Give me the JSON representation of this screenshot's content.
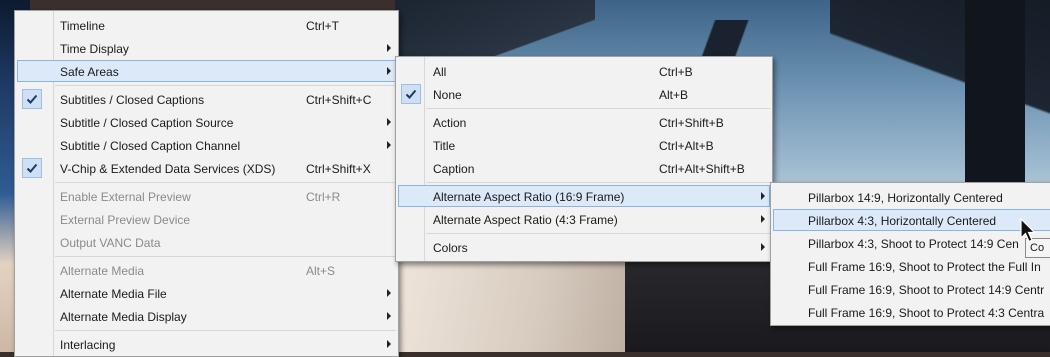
{
  "main_menu": {
    "items": [
      {
        "label": "Timeline",
        "shortcut": "Ctrl+T"
      },
      {
        "label": "Time Display",
        "shortcut": ""
      },
      {
        "label": "Safe Areas",
        "shortcut": ""
      },
      {
        "label": "Subtitles / Closed Captions",
        "shortcut": "Ctrl+Shift+C"
      },
      {
        "label": "Subtitle / Closed Caption Source",
        "shortcut": ""
      },
      {
        "label": "Subtitle / Closed Caption Channel",
        "shortcut": ""
      },
      {
        "label": "V-Chip & Extended Data Services (XDS)",
        "shortcut": "Ctrl+Shift+X"
      },
      {
        "label": "Enable External Preview",
        "shortcut": "Ctrl+R"
      },
      {
        "label": "External Preview Device",
        "shortcut": ""
      },
      {
        "label": "Output VANC Data",
        "shortcut": ""
      },
      {
        "label": "Alternate Media",
        "shortcut": "Alt+S"
      },
      {
        "label": "Alternate Media File",
        "shortcut": ""
      },
      {
        "label": "Alternate Media Display",
        "shortcut": ""
      },
      {
        "label": "Interlacing",
        "shortcut": ""
      }
    ]
  },
  "safe_areas_menu": {
    "items": [
      {
        "label": "All",
        "shortcut": "Ctrl+B"
      },
      {
        "label": "None",
        "shortcut": "Alt+B"
      },
      {
        "label": "Action",
        "shortcut": "Ctrl+Shift+B"
      },
      {
        "label": "Title",
        "shortcut": "Ctrl+Alt+B"
      },
      {
        "label": "Caption",
        "shortcut": "Ctrl+Alt+Shift+B"
      },
      {
        "label": "Alternate Aspect Ratio (16:9 Frame)",
        "shortcut": ""
      },
      {
        "label": "Alternate Aspect Ratio (4:3 Frame)",
        "shortcut": ""
      },
      {
        "label": "Colors",
        "shortcut": ""
      }
    ]
  },
  "aspect_menu": {
    "items": [
      {
        "label": "Pillarbox 14:9, Horizontally Centered"
      },
      {
        "label": "Pillarbox 4:3, Horizontally Centered"
      },
      {
        "label": "Pillarbox 4:3, Shoot to Protect 14:9 Cen"
      },
      {
        "label": "Full Frame 16:9, Shoot to Protect the Full In"
      },
      {
        "label": "Full Frame 16:9, Shoot to Protect 14:9 Centr"
      },
      {
        "label": "Full Frame 16:9, Shoot to Protect 4:3 Centra"
      }
    ]
  },
  "tooltip": {
    "text": "Co"
  },
  "colors": {
    "highlight_bg": "#dbe9f9",
    "highlight_border": "#8bb4e6",
    "menu_bg": "#f2f2f2"
  }
}
